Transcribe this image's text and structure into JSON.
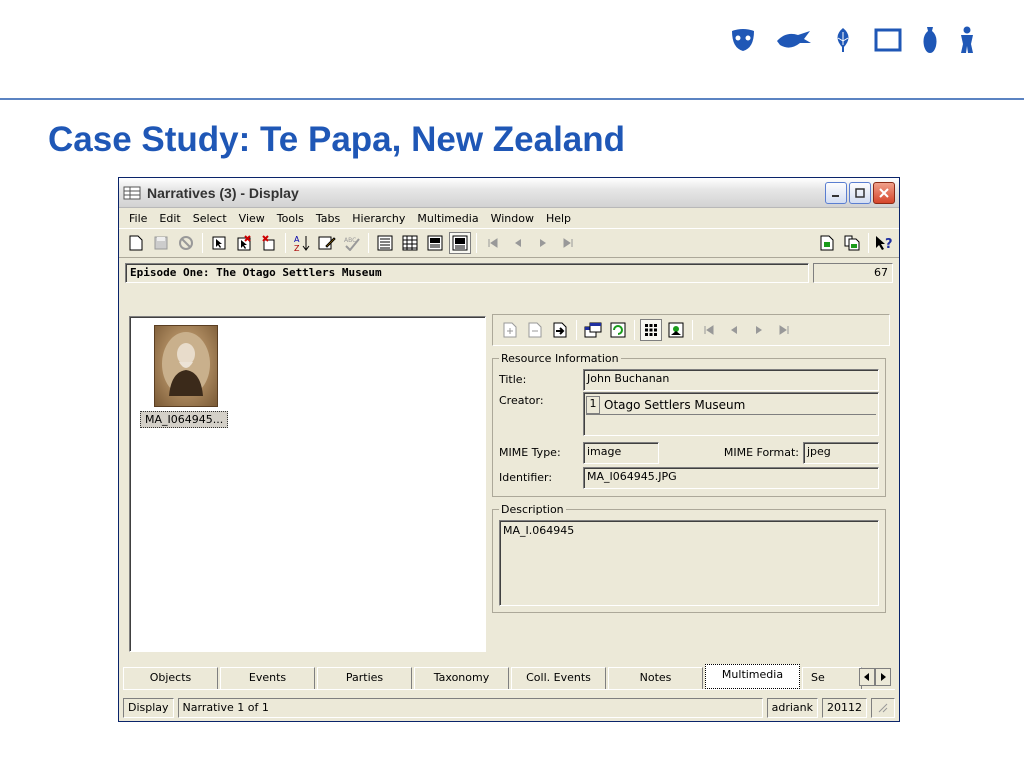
{
  "slide": {
    "title": "Case Study: Te Papa, New Zealand",
    "brand_color": "#1f57b6",
    "logo_icons": [
      "mask-icon",
      "bird-icon",
      "leaf-icon",
      "frame-icon",
      "vase-icon",
      "figure-icon"
    ]
  },
  "window": {
    "title": "Narratives (3) - Display",
    "menu": [
      "File",
      "Edit",
      "Select",
      "View",
      "Tools",
      "Tabs",
      "Hierarchy",
      "Multimedia",
      "Window",
      "Help"
    ],
    "narrative": {
      "name": "Episode One: The Otago Settlers Museum",
      "count": "67"
    },
    "multimedia": {
      "thumbnail_label": "MA_I064945..."
    },
    "resource": {
      "legend": "Resource Information",
      "title_label": "Title:",
      "title_value": "John Buchanan",
      "creator_label": "Creator:",
      "creator_index": "1",
      "creator_value": "Otago Settlers Museum",
      "mime_type_label": "MIME Type:",
      "mime_type_value": "image",
      "mime_format_label": "MIME Format:",
      "mime_format_value": "jpeg",
      "identifier_label": "Identifier:",
      "identifier_value": "MA_I064945.JPG"
    },
    "description": {
      "legend": "Description",
      "value": "MA_I.064945"
    },
    "tabs": [
      "Objects",
      "Events",
      "Parties",
      "Taxonomy",
      "Coll. Events",
      "Notes",
      "Multimedia",
      "Se"
    ],
    "active_tab": "Multimedia",
    "status": {
      "mode": "Display",
      "record": "Narrative 1 of 1",
      "user": "adriank",
      "number": "20112"
    }
  }
}
